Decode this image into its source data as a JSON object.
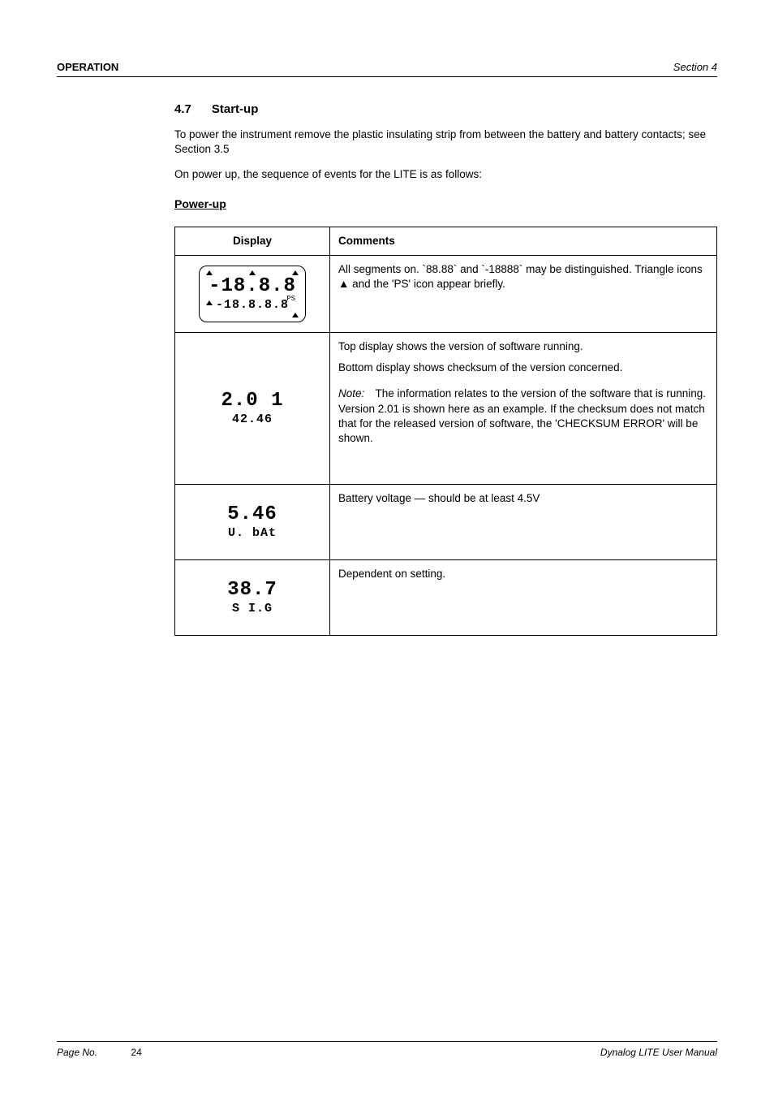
{
  "header": {
    "left": "OPERATION",
    "right": "Section 4"
  },
  "section": {
    "num": "4.7",
    "title": "Start-up"
  },
  "body": {
    "p1": "To power the instrument remove the plastic insulating strip from between the battery and battery contacts; see Section 3.5",
    "p2": "On power up, the sequence of events for the LITE is as follows:",
    "sub": "Power-up"
  },
  "table": {
    "headers": [
      "Display",
      "Comments"
    ],
    "rows": [
      {
        "lcd_row1": "-18.8.8",
        "lcd_row2": "-18.8.8.8",
        "lcd_extra": "PS",
        "triangles": true,
        "desc": "All segments on. `88.88` and `-18888` may be distinguished. Triangle icons ▲ and the 'PS' icon appear briefly."
      },
      {
        "lcd_row1": "2.0 1",
        "lcd_row2": "42.46",
        "lcd_extra": "",
        "triangles": false,
        "note_label": "Note:",
        "desc_line1": "Top display shows the version of software running.",
        "desc_line2": "Bottom display shows checksum of the version concerned.",
        "note_text": "The information relates to the version of the software that is running. Version 2.01 is shown here as an example. If the checksum does not match that for the released version of software, the 'CHECKSUM ERROR' will be shown."
      },
      {
        "lcd_row1": "5.46",
        "lcd_row2": "U. bAt",
        "lcd_extra": "",
        "triangles": false,
        "desc": "Battery voltage — should be at least 4.5V"
      },
      {
        "lcd_row1": "38.7",
        "lcd_row2": "S I.G",
        "lcd_extra": "",
        "triangles": false,
        "desc": "Dependent on setting."
      }
    ]
  },
  "footer": {
    "page_label": "Page No.",
    "page_val": "24",
    "right": "Dynalog LITE User Manual"
  }
}
